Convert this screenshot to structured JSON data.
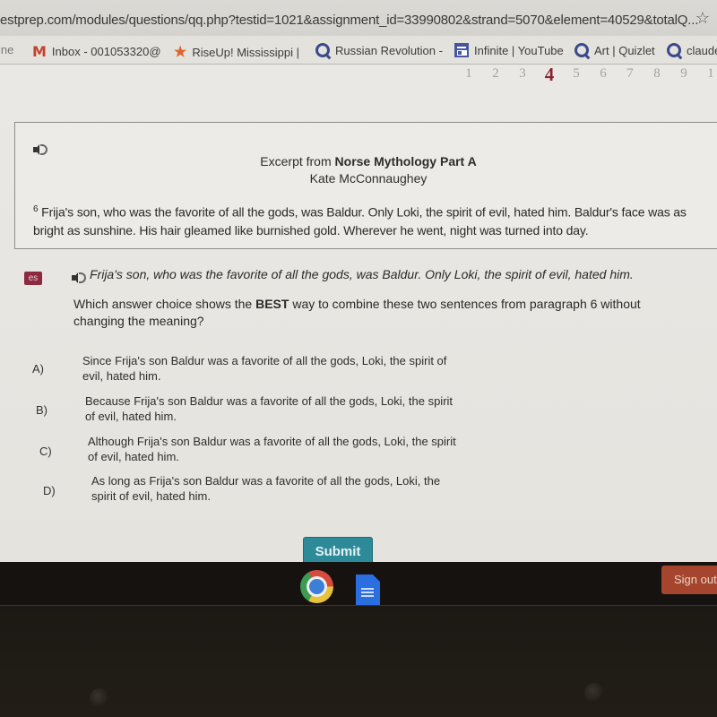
{
  "browser": {
    "url": "estprep.com/modules/questions/qq.php?testid=1021&assignment_id=33990802&strand=5070&element=40529&totalQ...",
    "bookmark_star_icon": "star-outline-icon",
    "bookmarks": [
      {
        "label": "ine",
        "icon": "none"
      },
      {
        "label": "Inbox - 001053320@",
        "icon": "gmail-icon"
      },
      {
        "label": "RiseUp! Mississippi |",
        "icon": "star-icon"
      },
      {
        "label": "Russian Revolution -",
        "icon": "quizlet-icon"
      },
      {
        "label": "Infinite | YouTube",
        "icon": "calendar-app-icon"
      },
      {
        "label": "Art | Quizlet",
        "icon": "quizlet-icon"
      },
      {
        "label": "claude",
        "icon": "quizlet-icon"
      }
    ]
  },
  "question_nav": {
    "numbers": [
      "1",
      "2",
      "3",
      "4",
      "5",
      "6",
      "7",
      "8",
      "9",
      "1"
    ],
    "current": "4"
  },
  "passage": {
    "title_prefix": "Excerpt from ",
    "title_bold": "Norse Mythology Part A",
    "author": "Kate McConnaughey",
    "paragraph_number": "6",
    "text": "Frija's son, who was the favorite of all the gods, was Baldur. Only Loki, the spirit of evil, hated him. Baldur's face was as bright as sunshine. His hair gleamed like burnished gold. Wherever he went, night was turned into day."
  },
  "question": {
    "badge": "es",
    "quote": "Frija's son, who was the favorite of all the gods, was Baldur. Only Loki, the spirit of evil, hated him.",
    "prompt_before": "Which answer choice shows the ",
    "prompt_bold": "BEST",
    "prompt_after": " way to combine these two sentences from paragraph 6 without changing the meaning?",
    "choices": [
      {
        "letter": "A)",
        "text": "Since Frija's son Baldur was a favorite of all the gods, Loki, the spirit of evil, hated him."
      },
      {
        "letter": "B)",
        "text": "Because Frija's son Baldur was a favorite of all the gods, Loki, the spirit of evil, hated him."
      },
      {
        "letter": "C)",
        "text": "Although Frija's son Baldur was a favorite of all the gods, Loki, the spirit of evil, hated him."
      },
      {
        "letter": "D)",
        "text": "As long as Frija's son Baldur was a favorite of all the gods, Loki, the spirit of evil, hated him."
      }
    ],
    "submit_label": "Submit"
  },
  "shelf": {
    "apps": [
      "chrome-icon",
      "google-docs-icon"
    ],
    "signout_label": "Sign out"
  },
  "colors": {
    "current_question": "#8c2435",
    "submit": "#2d8a99",
    "signout": "#a5452e",
    "es_badge": "#8c2a40"
  }
}
